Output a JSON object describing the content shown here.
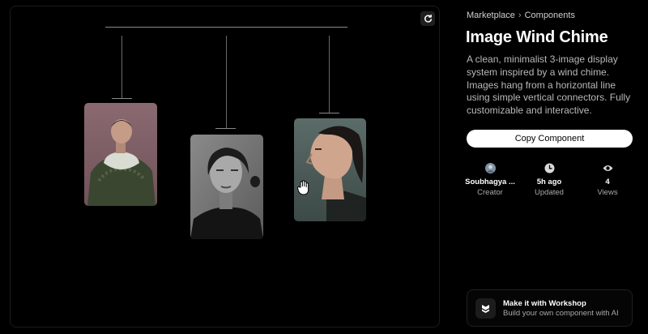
{
  "breadcrumb": {
    "root": "Marketplace",
    "separator": "›",
    "current": "Components"
  },
  "component": {
    "title": "Image Wind Chime",
    "description": "A clean, minimalist 3-image display system inspired by a wind chime. Images hang from a horizontal line using simple vertical connectors. Fully customizable and interactive."
  },
  "actions": {
    "copy_label": "Copy Component"
  },
  "stats": {
    "creator": {
      "value": "Soubhagya ...",
      "label": "Creator",
      "icon": "avatar"
    },
    "updated": {
      "value": "5h ago",
      "label": "Updated",
      "icon": "clock-icon"
    },
    "views": {
      "value": "4",
      "label": "Views",
      "icon": "eye-icon"
    }
  },
  "workshop": {
    "title": "Make it with Workshop",
    "subtitle": "Build your own component with AI",
    "icon": "workshop-logo-icon"
  },
  "preview": {
    "images": [
      "portrait-pink-background",
      "portrait-black-and-white",
      "portrait-profile-teal"
    ]
  },
  "colors": {
    "background": "#000000",
    "accent_button": "#ffffff",
    "muted_text": "#b9b9b9"
  }
}
